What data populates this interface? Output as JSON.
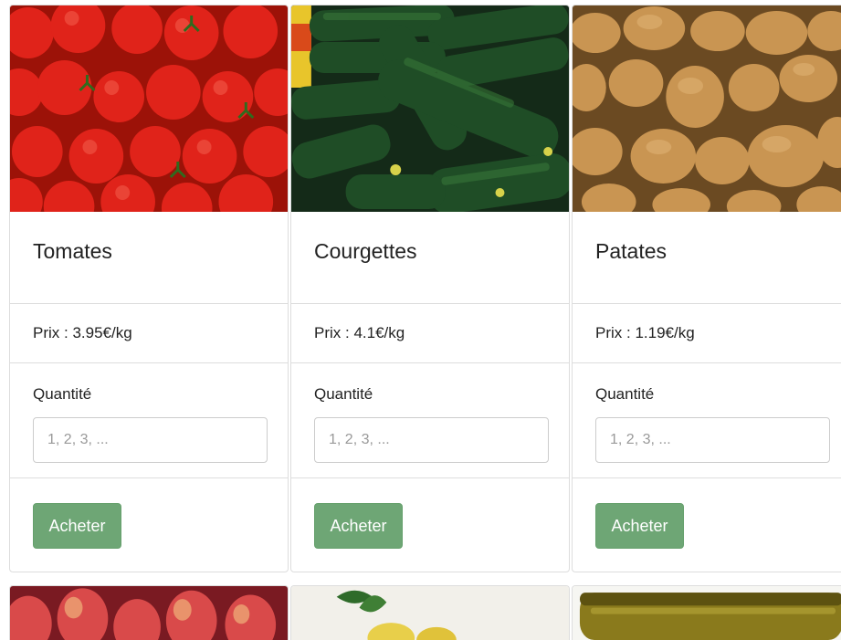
{
  "products": [
    {
      "name": "Tomates",
      "price": "Prix : 3.95€/kg",
      "quantity_label": "Quantité",
      "quantity_placeholder": "1, 2, 3, ...",
      "buy_label": "Acheter"
    },
    {
      "name": "Courgettes",
      "price": "Prix : 4.1€/kg",
      "quantity_label": "Quantité",
      "quantity_placeholder": "1, 2, 3, ...",
      "buy_label": "Acheter"
    },
    {
      "name": "Patates",
      "price": "Prix : 1.19€/kg",
      "quantity_label": "Quantité",
      "quantity_placeholder": "1, 2, 3, ...",
      "buy_label": "Acheter"
    }
  ],
  "colors": {
    "button_bg": "#6ea675",
    "border": "#dddddd"
  }
}
